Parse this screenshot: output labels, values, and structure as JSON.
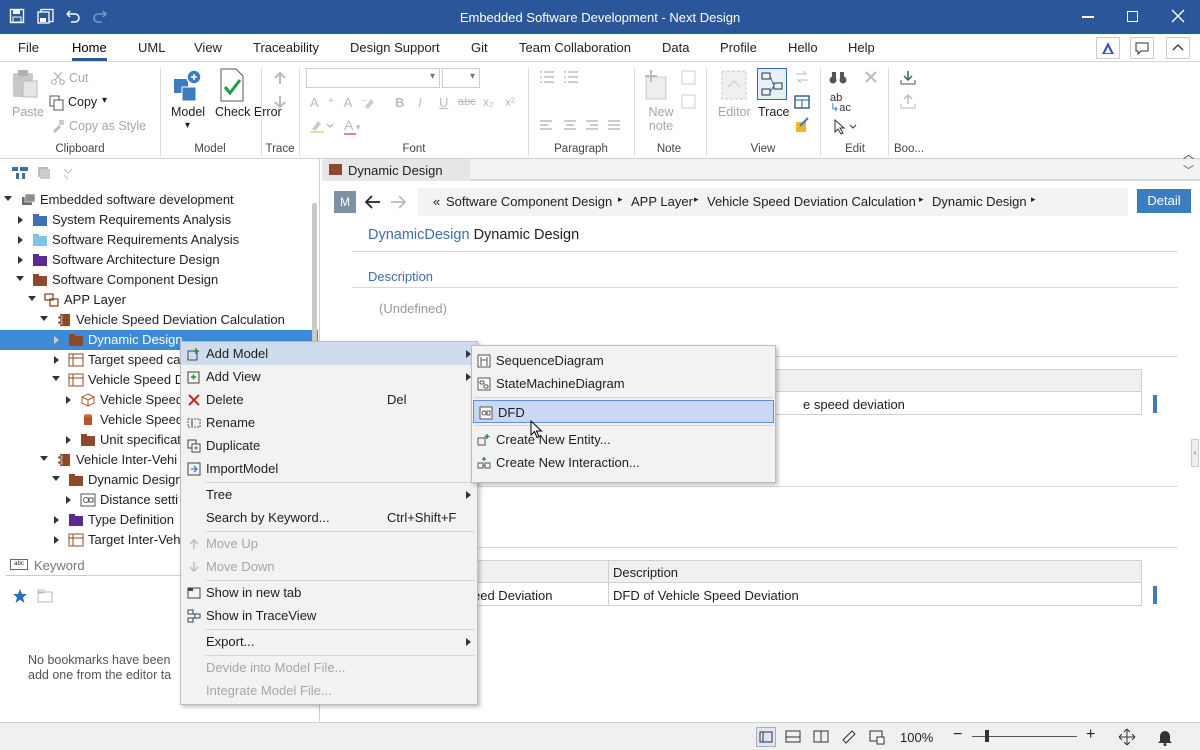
{
  "window": {
    "title": "Embedded Software Development - Next Design"
  },
  "menu": [
    "File",
    "Home",
    "UML",
    "View",
    "Traceability",
    "Design Support",
    "Git",
    "Team Collaboration",
    "Data",
    "Profile",
    "Hello",
    "Help"
  ],
  "ribbon": {
    "clipboard": {
      "paste": "Paste",
      "cut": "Cut",
      "copy": "Copy",
      "copy_as_style": "Copy as Style",
      "label": "Clipboard"
    },
    "model": {
      "model": "Model",
      "check_error": "Check Error",
      "label": "Model"
    },
    "trace": {
      "label": "Trace"
    },
    "font": {
      "label": "Font"
    },
    "paragraph": {
      "label": "Paragraph"
    },
    "note": {
      "new_note": "New note",
      "label": "Note"
    },
    "view": {
      "editor": "Editor",
      "trace": "Trace",
      "label": "View"
    },
    "edit": {
      "label": "Edit"
    },
    "bookmark": {
      "label": "Boo..."
    }
  },
  "tree": [
    {
      "label": "Embedded software development",
      "depth": 0,
      "arrow": "exp",
      "icon": "project"
    },
    {
      "label": "System Requirements Analysis",
      "depth": 1,
      "arrow": "col",
      "icon": "folder-blue"
    },
    {
      "label": "Software Requirements Analysis",
      "depth": 1,
      "arrow": "col",
      "icon": "folder-lightblue"
    },
    {
      "label": "Software Architecture Design",
      "depth": 1,
      "arrow": "col",
      "icon": "folder-purple"
    },
    {
      "label": "Software Component Design",
      "depth": 1,
      "arrow": "exp",
      "icon": "folder-brown"
    },
    {
      "label": "APP Layer",
      "depth": 2,
      "arrow": "exp",
      "icon": "layer"
    },
    {
      "label": "Vehicle Speed Deviation Calculation",
      "depth": 3,
      "arrow": "exp",
      "icon": "component"
    },
    {
      "label": "Dynamic Design",
      "depth": 4,
      "arrow": "col",
      "icon": "folder-brown",
      "selected": true
    },
    {
      "label": "Target speed ca",
      "depth": 4,
      "arrow": "col",
      "icon": "table"
    },
    {
      "label": "Vehicle Speed D",
      "depth": 4,
      "arrow": "exp",
      "icon": "table"
    },
    {
      "label": "Vehicle Speed",
      "depth": 5,
      "arrow": "col",
      "icon": "cube"
    },
    {
      "label": "Vehicle Speed",
      "depth": 5,
      "arrow": "none",
      "icon": "cylinder"
    },
    {
      "label": "Unit specificat",
      "depth": 5,
      "arrow": "col",
      "icon": "folder-brown"
    },
    {
      "label": "Vehicle Inter-Vehi",
      "depth": 3,
      "arrow": "exp",
      "icon": "component"
    },
    {
      "label": "Dynamic Design",
      "depth": 4,
      "arrow": "exp",
      "icon": "folder-brown"
    },
    {
      "label": "Distance setti",
      "depth": 5,
      "arrow": "col",
      "icon": "dfd"
    },
    {
      "label": "Type Definition",
      "depth": 4,
      "arrow": "col",
      "icon": "folder-purple"
    },
    {
      "label": "Target Inter-Vehi",
      "depth": 4,
      "arrow": "col",
      "icon": "table"
    }
  ],
  "search": {
    "placeholder": "Keyword"
  },
  "bookmarks": {
    "empty_line1": "No bookmarks have been",
    "empty_line2": "add one from the editor ta"
  },
  "editor": {
    "tab": "Dynamic Design",
    "badge": "M",
    "breadcrumb": [
      "Software Component Design",
      "APP Layer",
      "Vehicle Speed Deviation Calculation",
      "Dynamic Design"
    ],
    "breadcrumb_prefix": "«",
    "detail_button": "Detail",
    "type_name": "DynamicDesign",
    "name": "Dynamic Design",
    "description_label": "Description",
    "description_value": "(Undefined)",
    "table1_partial": "e speed deviation",
    "table2": {
      "header_desc": "Description",
      "row_name_partial": "eed Deviation",
      "row_desc": "DFD of Vehicle Speed Deviation"
    }
  },
  "context_menu": [
    {
      "label": "Add Model",
      "icon": "add-model-icon",
      "submenu": true,
      "highlight": true
    },
    {
      "label": "Add View",
      "icon": "add-view-icon",
      "submenu": true
    },
    {
      "label": "Delete",
      "icon": "delete-icon",
      "shortcut": "Del"
    },
    {
      "label": "Rename",
      "icon": "rename-icon"
    },
    {
      "label": "Duplicate",
      "icon": "duplicate-icon"
    },
    {
      "label": "ImportModel",
      "icon": "import-icon"
    },
    {
      "sep": true
    },
    {
      "label": "Tree",
      "submenu": true
    },
    {
      "label": "Search by Keyword...",
      "shortcut": "Ctrl+Shift+F"
    },
    {
      "sep": true
    },
    {
      "label": "Move Up",
      "icon": "arrow-up-icon",
      "disabled": true
    },
    {
      "label": "Move Down",
      "icon": "arrow-down-icon",
      "disabled": true
    },
    {
      "sep": true
    },
    {
      "label": "Show in new tab",
      "icon": "new-tab-icon"
    },
    {
      "label": "Show in TraceView",
      "icon": "trace-view-icon"
    },
    {
      "sep": true
    },
    {
      "label": "Export...",
      "submenu": true
    },
    {
      "sep": true
    },
    {
      "label": "Devide into Model File...",
      "disabled": true
    },
    {
      "label": "Integrate Model File...",
      "disabled": true
    }
  ],
  "submenu": [
    {
      "label": "SequenceDiagram"
    },
    {
      "label": "StateMachineDiagram"
    },
    {
      "sep": true
    },
    {
      "label": "DFD",
      "highlight": true
    },
    {
      "sep": true
    },
    {
      "label": "Create New Entity..."
    },
    {
      "label": "Create New Interaction..."
    }
  ],
  "status": {
    "zoom": "100%"
  },
  "colors": {
    "titlebar": "#2b579a",
    "selection": "#3d8bd4",
    "accent": "#3c7cc0"
  }
}
